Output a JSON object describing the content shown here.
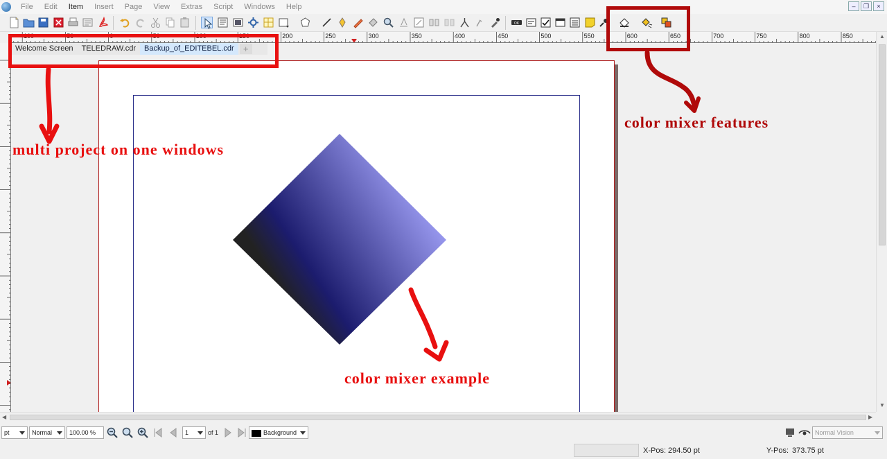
{
  "menubar": {
    "items": [
      "File",
      "Edit",
      "Item",
      "Insert",
      "Page",
      "View",
      "Extras",
      "Script",
      "Windows",
      "Help"
    ],
    "active_item": "Item"
  },
  "tabs": {
    "items": [
      "Welcome Screen",
      "TELEDRAW.cdr",
      "Backup_of_EDITEBEL.cdr"
    ],
    "add_label": "+"
  },
  "ruler": {
    "labels": [
      "100",
      "50",
      "0",
      "50",
      "100",
      "150",
      "200",
      "250",
      "300",
      "350",
      "400",
      "450",
      "500",
      "550",
      "600",
      "650",
      "700",
      "750",
      "800",
      "850"
    ]
  },
  "bottombar": {
    "unit": "pt",
    "mode": "Normal",
    "zoom": "100.00 %",
    "page_number": "1",
    "page_of": "of 1",
    "layer": "Background",
    "vision": "Normal Vision"
  },
  "statusbar": {
    "x_label": "X-Pos:",
    "x_value": "294.50 pt",
    "y_label": "Y-Pos:",
    "y_value": "373.75 pt"
  },
  "annotations": {
    "multi_project": "multi project on one windows",
    "mixer_features": "color mixer features",
    "mixer_example": "color mixer example"
  },
  "colors": {
    "annotation_red": "#e81010",
    "annotation_dark_red": "#b00a0a",
    "margin_blue": "#2a2f8a",
    "gradient_dark": "#222222",
    "gradient_navy": "#1c1c6e",
    "gradient_light": "#a8a8ff"
  }
}
